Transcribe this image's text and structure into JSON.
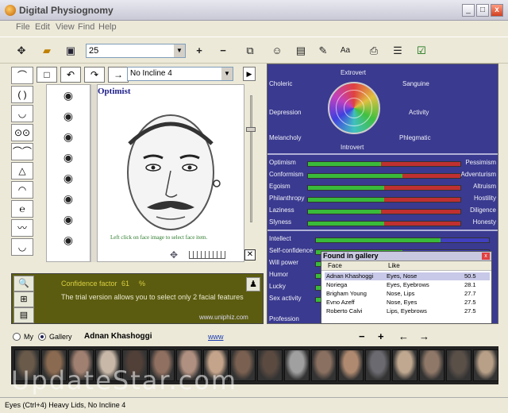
{
  "window": {
    "title": "Digital Physiognomy",
    "min": "_",
    "max": "□",
    "close": "x"
  },
  "menu": [
    "File",
    "Edit",
    "View",
    "Find",
    "Help"
  ],
  "toolbar": {
    "zoom_value": "25"
  },
  "editor": {
    "incline": "No Incline 4",
    "face_title": "Optimist",
    "hint": "Left click on face image to select face item."
  },
  "info": {
    "confidence_label": "Confidence factor",
    "confidence_value": "61",
    "confidence_unit": "%",
    "trial_text": "The trial version allows you to select only 2 facial features",
    "url": "www.uniphiz.com"
  },
  "temperament": {
    "top": "Extrovert",
    "bottom": "Introvert",
    "labels": [
      "Choleric",
      "Sanguine",
      "Depression",
      "Activity",
      "Melancholy",
      "Phlegmatic"
    ]
  },
  "traits": [
    {
      "left": "Optimism",
      "right": "Pessimism",
      "level": 0.48
    },
    {
      "left": "Conformism",
      "right": "Adventurism",
      "level": 0.62
    },
    {
      "left": "Egoism",
      "right": "Altruism",
      "level": 0.5
    },
    {
      "left": "Philanthropy",
      "right": "Hostility",
      "level": 0.5
    },
    {
      "left": "Laziness",
      "right": "Diligence",
      "level": 0.48
    },
    {
      "left": "Slyness",
      "right": "Honesty",
      "level": 0.5
    }
  ],
  "qualities": [
    {
      "label": "Intellect",
      "level": 0.72
    },
    {
      "label": "Self-confidence",
      "level": 0.5
    },
    {
      "label": "Will power",
      "level": 0.6
    },
    {
      "label": "Humor",
      "level": 0.5
    },
    {
      "label": "Lucky",
      "level": 0.5
    },
    {
      "label": "Sex activity",
      "level": 0.5
    }
  ],
  "profession_label": "Profession",
  "gallery_popup": {
    "title": "Found in gallery",
    "columns": [
      "Face",
      "Like",
      ""
    ],
    "rows": [
      [
        "Adnan Khashoggi",
        "Eyes, Nose",
        "50.5"
      ],
      [
        "Noriega",
        "Eyes, Eyebrows",
        "28.1"
      ],
      [
        "Brigham Young",
        "Nose, Lips",
        "27.7"
      ],
      [
        "Evno Azeff",
        "Nose, Eyes",
        "27.5"
      ],
      [
        "Roberto Calvi",
        "Lips, Eyebrows",
        "27.5"
      ]
    ]
  },
  "bottom": {
    "my_label": "My",
    "gallery_label": "Gallery",
    "person": "Adnan Khashoggi",
    "link": "www"
  },
  "watermark": "UpdateStar.com",
  "status": "Eyes (Ctrl+4) Heavy Lids, No Incline 4",
  "colors": {
    "panel_blue": "#3a3a90",
    "info_olive": "#5c5c10",
    "bar_green": "#3aba3a",
    "bar_red": "#c03030"
  }
}
